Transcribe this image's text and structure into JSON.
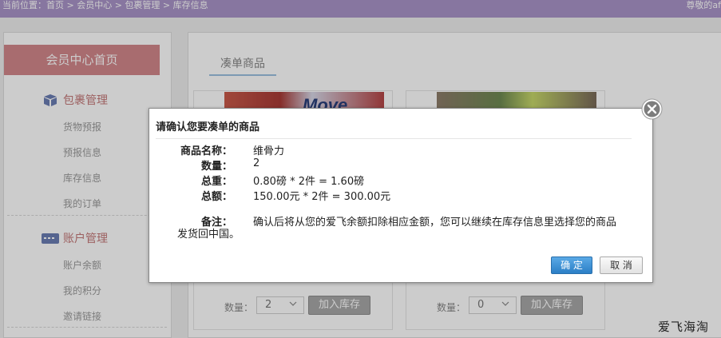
{
  "topbar": {
    "breadcrumb": "当前位置：首页 > 会员中心 > 包裹管理 > 库存信息",
    "greeting": "尊敬的af"
  },
  "sidebar": {
    "home": "会员中心首页",
    "group1": {
      "label": "包裹管理",
      "icon": "package-icon",
      "items": [
        "货物预报",
        "预报信息",
        "库存信息",
        "我的订单"
      ]
    },
    "group2": {
      "label": "账户管理",
      "icon": "card-icon",
      "items": [
        "账户余额",
        "我的积分",
        "邀请链接"
      ]
    }
  },
  "main": {
    "tab": "凑单商品",
    "cards": [
      {
        "qty_label": "数量：",
        "qty_value": "2",
        "add_label": "加入库存",
        "image_text": "Move"
      },
      {
        "qty_label": "数量：",
        "qty_value": "0",
        "add_label": "加入库存"
      }
    ]
  },
  "dialog": {
    "title": "请确认您要凑单的商品",
    "fields": [
      {
        "key": "商品名称：",
        "value": "维骨力"
      },
      {
        "key": "数量：",
        "value": "2"
      },
      {
        "key": "总重：",
        "value": "0.80磅 * 2件 = 1.60磅"
      },
      {
        "key": "总额：",
        "value": "150.00元 * 2件 = 300.00元"
      }
    ],
    "note_key": "备注：",
    "note_line1": "确认后将从您的爱飞余额扣除相应金额，您可以继续在库存信息里选择您的商品",
    "note_line2": "发货回中国。",
    "ok": "确 定",
    "cancel": "取 消"
  },
  "watermark": "爱飞海淘",
  "colors": {
    "topbar": "#a994c8",
    "home": "#d2888b",
    "accent": "#2b7fc6"
  }
}
